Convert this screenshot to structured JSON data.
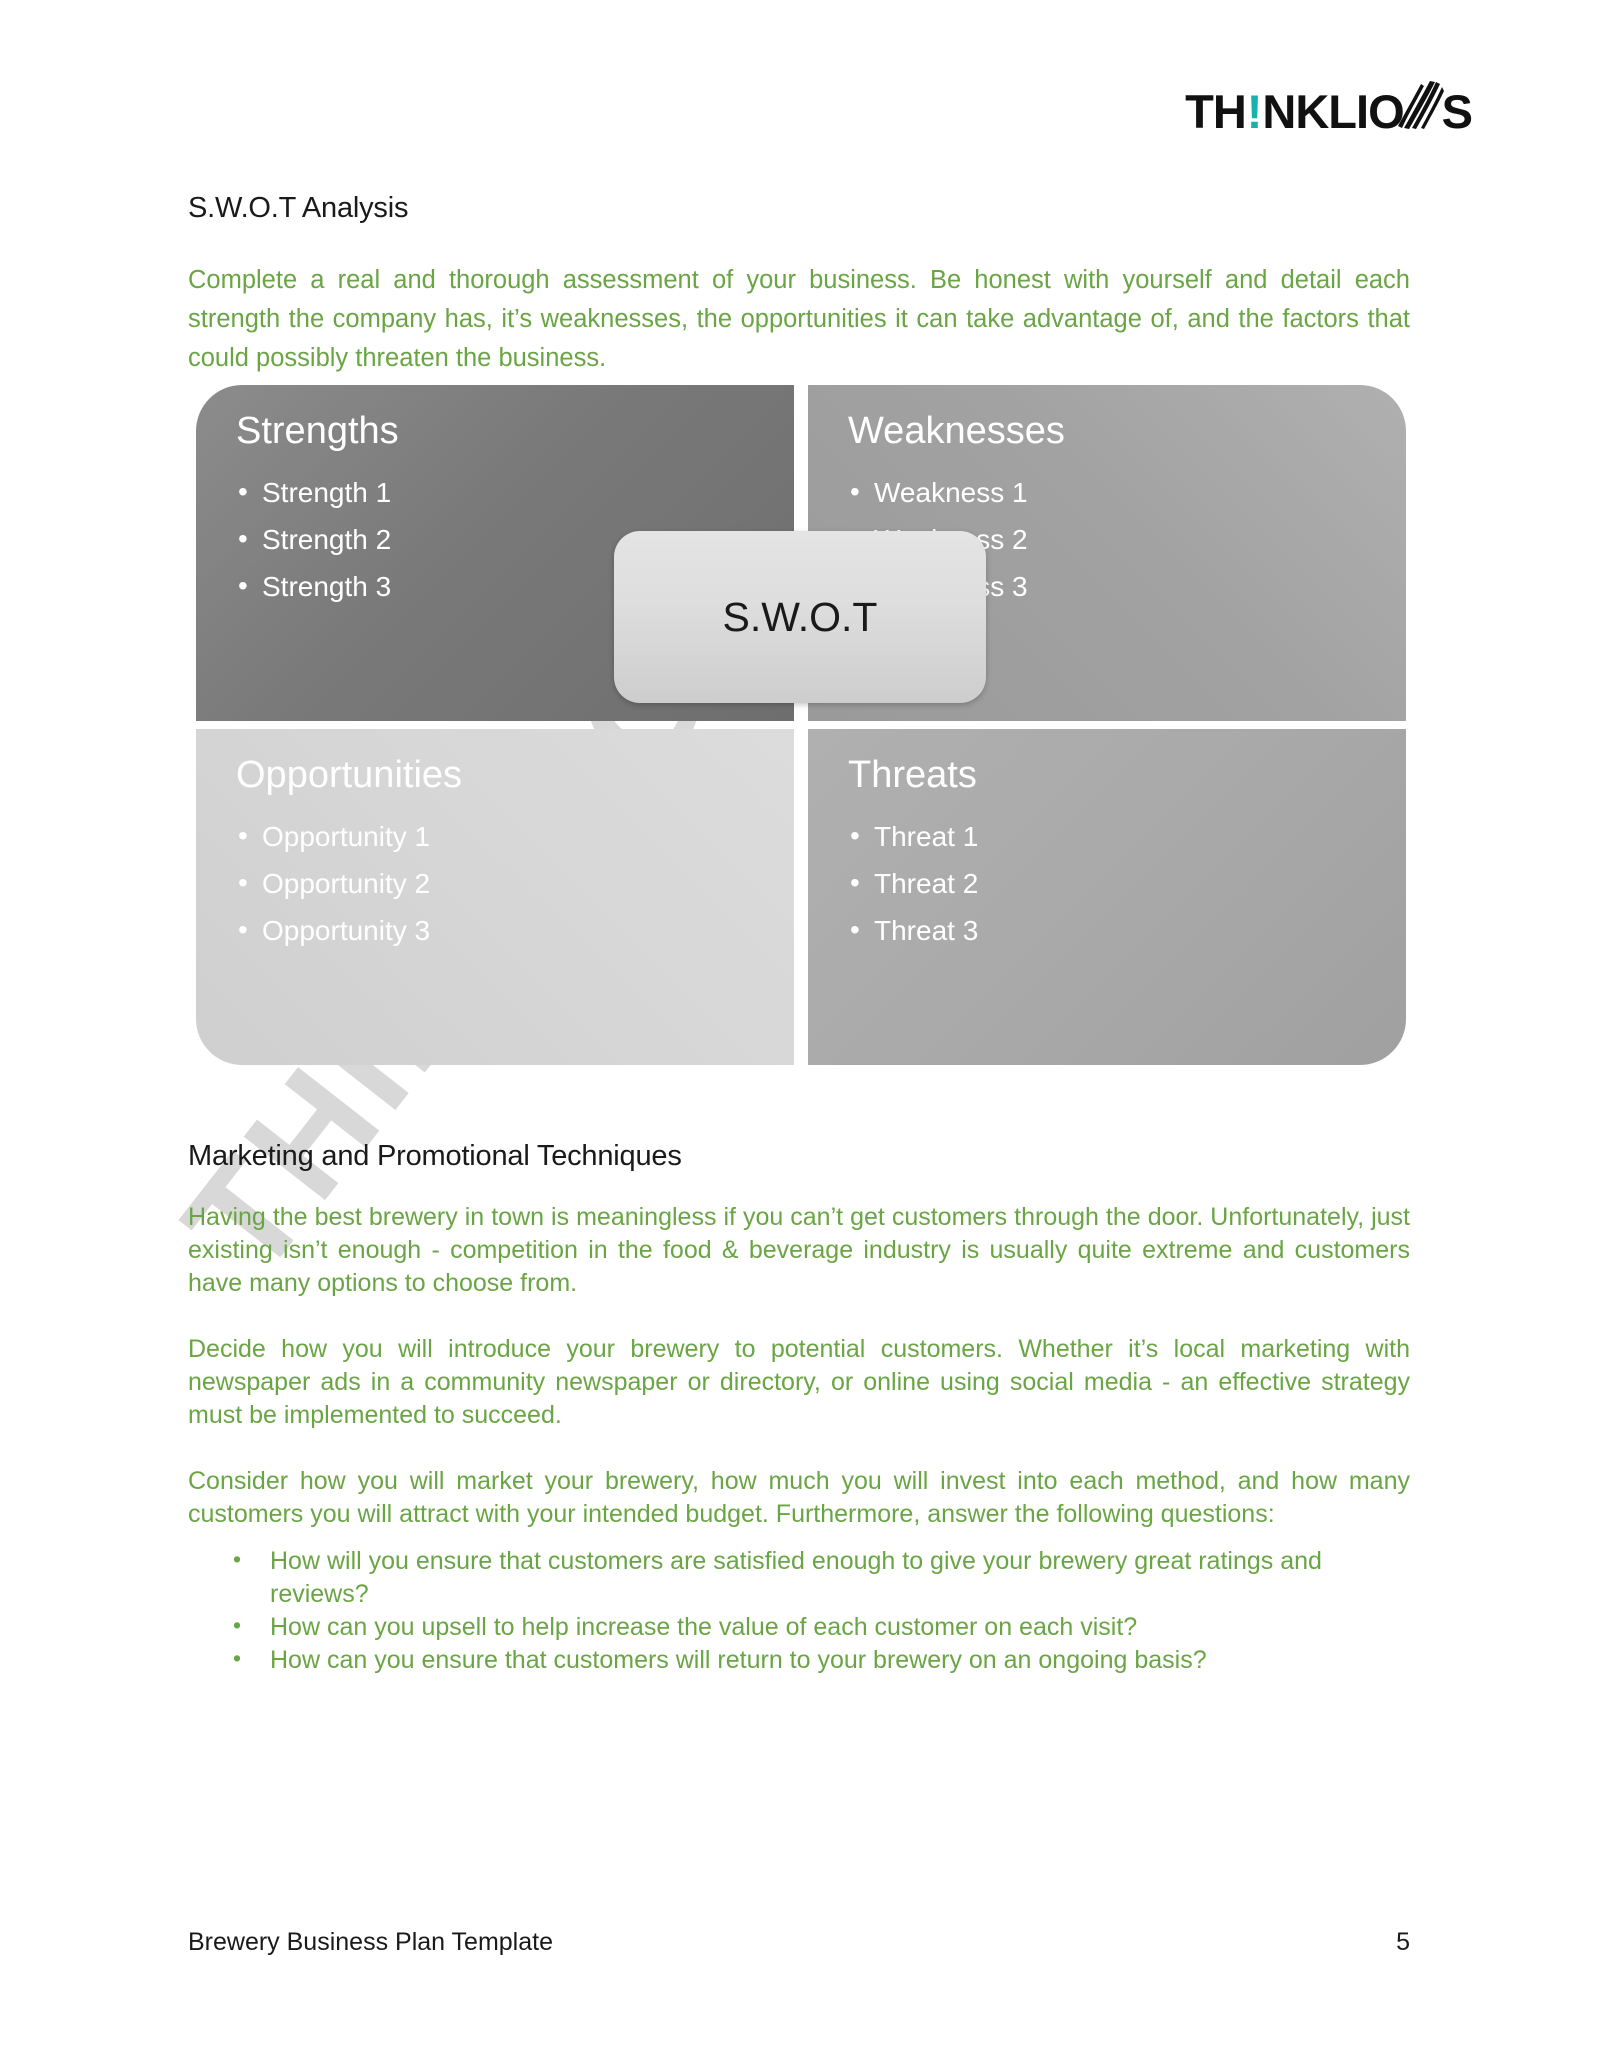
{
  "brand": {
    "logo_part1": "TH",
    "logo_bang": "!",
    "logo_part2": "NKLIO",
    "logo_part3": "S",
    "logo_full": "TH!NKLIONS",
    "accent_color": "#16b3ac"
  },
  "watermark": {
    "text": "THINKLIO"
  },
  "sections": {
    "swot": {
      "title": "S.W.O.T Analysis",
      "intro": "Complete a real and thorough assessment of your business. Be honest with yourself and detail each strength the company has, it’s weaknesses, the opportunities it can take advantage of, and the factors that could possibly threaten the business."
    },
    "marketing": {
      "title": "Marketing and Promotional Techniques",
      "paragraphs": [
        "Having the best brewery in town is meaningless if you can’t get customers through the door. Unfortunately, just existing isn’t enough - competition in the food & beverage industry is usually quite extreme and customers have many options to choose from.",
        "Decide how you will introduce your brewery to potential customers. Whether it’s local marketing with newspaper ads in a community newspaper or directory, or online using social media - an effective strategy must be implemented to succeed.",
        "Consider how you will market your brewery, how much you will invest into each method, and how many customers you will attract with your intended budget. Furthermore, answer the following questions:"
      ],
      "questions": [
        "How will you ensure that customers are satisfied enough to give your brewery great ratings and reviews?",
        "How can you upsell to help increase the value of each customer on each visit?",
        "How can you ensure that customers will return to your brewery on an ongoing basis?"
      ]
    }
  },
  "swot_matrix": {
    "center_label": "S.W.O.T",
    "quadrants": {
      "strengths": {
        "title": "Strengths",
        "items": [
          "Strength 1",
          "Strength 2",
          "Strength 3"
        ],
        "color": "#797979"
      },
      "weaknesses": {
        "title": "Weaknesses",
        "items": [
          "Weakness 1",
          "Weakness 2",
          "Weakness 3"
        ],
        "color": "#a2a2a2"
      },
      "opportunities": {
        "title": "Opportunities",
        "items": [
          "Opportunity 1",
          "Opportunity 2",
          "Opportunity 3"
        ],
        "color": "#d6d6d6"
      },
      "threats": {
        "title": "Threats",
        "items": [
          "Threat 1",
          "Threat 2",
          "Threat 3"
        ],
        "color": "#a9a9a9"
      }
    }
  },
  "footer": {
    "label": "Brewery Business Plan Template",
    "page": "5"
  }
}
